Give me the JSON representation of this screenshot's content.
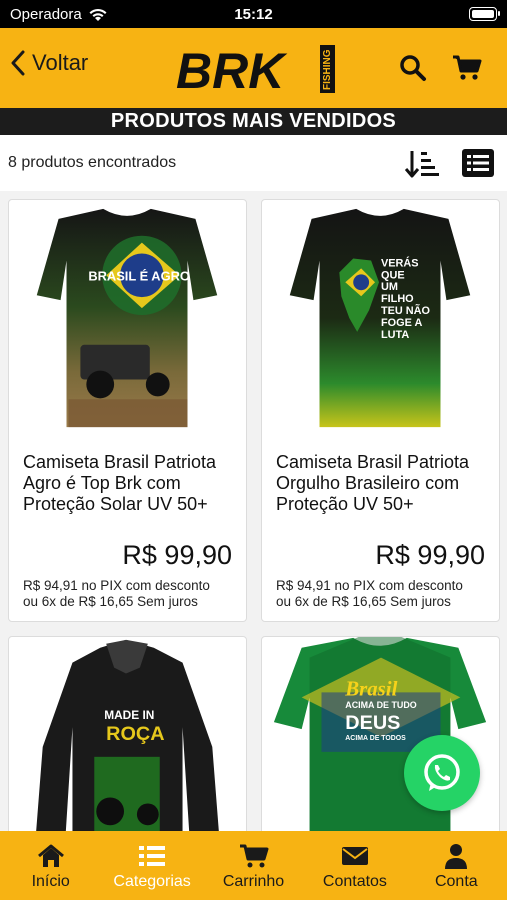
{
  "status_bar": {
    "carrier": "Operadora",
    "time": "15:12"
  },
  "header": {
    "back_label": "Voltar",
    "logo_text": "BRK",
    "logo_sub": "FISHING"
  },
  "section_title": "PRODUTOS MAIS VENDIDOS",
  "toolbar": {
    "count_text": "8 produtos encontrados"
  },
  "products": [
    {
      "name": "Camiseta Brasil Patriota Agro é Top Brk com Proteção Solar UV 50+",
      "price": "R$ 99,90",
      "pix_line1": "R$ 94,91 no PIX com desconto",
      "pix_line2": "ou 6x de R$ 16,65 Sem juros",
      "shirt_text": "BRASIL É AGRO"
    },
    {
      "name": "Camiseta Brasil Patriota Orgulho Brasileiro com Proteção UV 50+",
      "price": "R$ 99,90",
      "pix_line1": "R$ 94,91 no PIX com desconto",
      "pix_line2": "ou 6x de R$ 16,65 Sem juros",
      "shirt_text": [
        "VERÁS",
        "QUE",
        "UM",
        "FILHO",
        "TEU NÃO",
        "FOGE A",
        "LUTA"
      ]
    },
    {
      "shirt_text": [
        "MADE IN",
        "ROÇA"
      ]
    },
    {
      "shirt_text": [
        "Brasil",
        "ACIMA DE TUDO",
        "DEUS",
        "ACIMA DE TODOS"
      ]
    }
  ],
  "bottom_nav": [
    {
      "label": "Início",
      "icon": "home-icon"
    },
    {
      "label": "Categorias",
      "icon": "list-icon",
      "active": true
    },
    {
      "label": "Carrinho",
      "icon": "cart-icon"
    },
    {
      "label": "Contatos",
      "icon": "mail-icon"
    },
    {
      "label": "Conta",
      "icon": "user-icon"
    }
  ],
  "colors": {
    "accent": "#f7b313",
    "dark": "#1c1c1c",
    "whatsapp": "#25d366"
  }
}
